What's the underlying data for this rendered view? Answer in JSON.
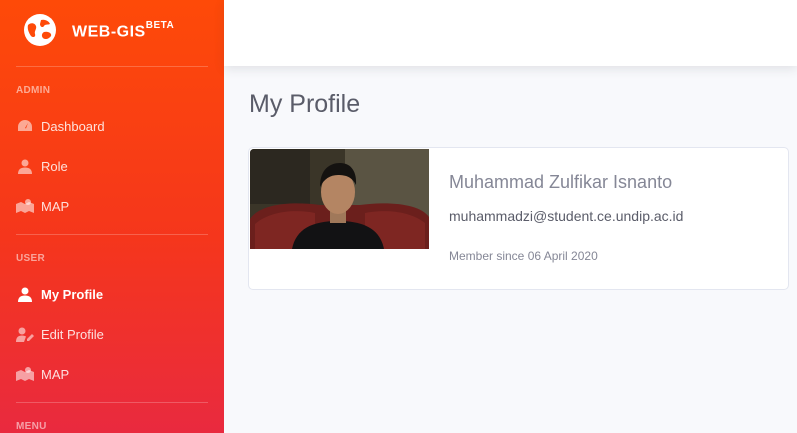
{
  "brand": {
    "name": "WEB-GIS",
    "sup": "BETA",
    "logo_icon": "globe-icon"
  },
  "sidebar": {
    "sections": [
      {
        "heading": "ADMIN",
        "items": [
          {
            "label": "Dashboard",
            "icon": "tachometer-icon"
          },
          {
            "label": "Role",
            "icon": "user-icon"
          },
          {
            "label": "MAP",
            "icon": "map-marked-icon"
          }
        ]
      },
      {
        "heading": "USER",
        "items": [
          {
            "label": "My Profile",
            "icon": "user-icon",
            "active": true
          },
          {
            "label": "Edit Profile",
            "icon": "user-edit-icon"
          },
          {
            "label": "MAP",
            "icon": "map-marked-icon"
          }
        ]
      },
      {
        "heading": "MENU",
        "items": []
      }
    ]
  },
  "main": {
    "title": "My Profile",
    "profile": {
      "name": "Muhammad Zulfikar Isnanto",
      "email": "muhammadzi@student.ce.undip.ac.id",
      "member_since": "Member since 06 April 2020"
    }
  },
  "colors": {
    "sidebar_top": "#fe4a08",
    "sidebar_bottom": "#e92a3f",
    "text_muted": "#858796",
    "text_dark": "#5a5c69"
  }
}
